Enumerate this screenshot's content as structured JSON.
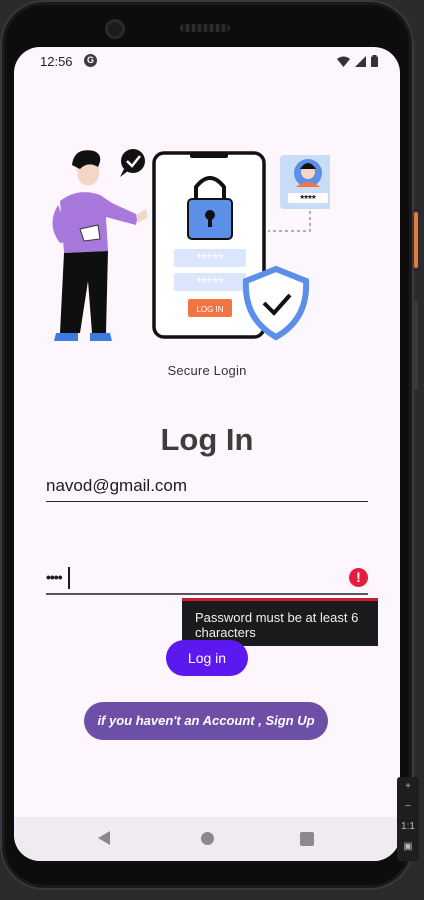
{
  "status_bar": {
    "time": "12:56",
    "g_badge": "G"
  },
  "illustration": {
    "caption": "Secure Login",
    "button_text": "LOG IN",
    "pin_masks": [
      "*****",
      "*****"
    ],
    "id_pin": "****"
  },
  "page": {
    "title": "Log In"
  },
  "form": {
    "email_value": "navod@gmail.com",
    "password_dots": "••••",
    "password_error": "Password must be at least 6 characters",
    "login_label": "Log in",
    "signup_label": "if you haven't an Account , Sign Up"
  },
  "colors": {
    "login_button": "#5b19ef",
    "signup_button": "#6d4fa8",
    "error": "#e41d3d",
    "background": "#fdf7fd"
  },
  "emulator_toolbar": {
    "zoom_label": "1:1",
    "plus": "+",
    "minus": "−"
  }
}
